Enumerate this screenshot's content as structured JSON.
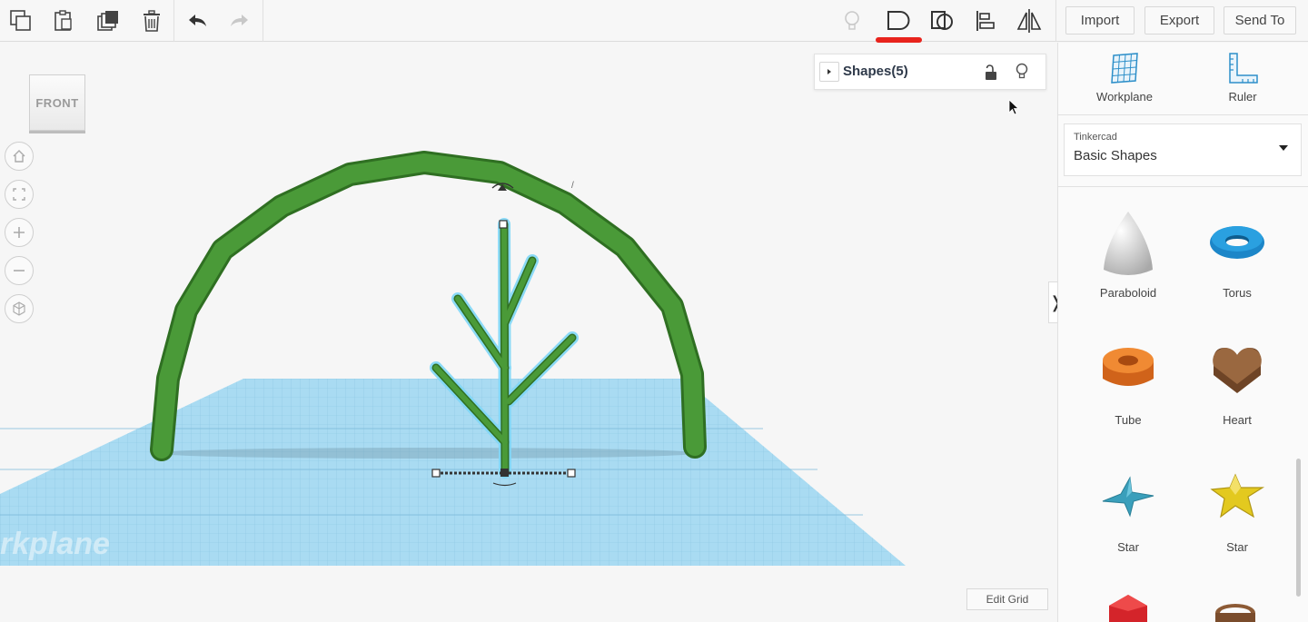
{
  "toolbar": {
    "import_label": "Import",
    "export_label": "Export",
    "send_to_label": "Send To",
    "icons": [
      "copy-icon",
      "paste-icon",
      "duplicate-icon",
      "delete-icon",
      "undo-icon",
      "redo-icon",
      "light-bulb-icon",
      "group-icon",
      "ungroup-icon",
      "align-icon",
      "mirror-icon"
    ]
  },
  "viewport": {
    "view_cube_label": "FRONT",
    "nav_icons": [
      "home-icon",
      "fit-view-icon",
      "zoom-in-icon",
      "zoom-out-icon",
      "perspective-icon"
    ],
    "workplane_watermark": "Workplane",
    "edit_grid_label": "Edit Grid",
    "collapse_tab_glyph": "❭"
  },
  "shapes_panel": {
    "title": "Shapes(5)"
  },
  "right_panel": {
    "tools": [
      {
        "label": "Workplane",
        "icon": "workplane-icon"
      },
      {
        "label": "Ruler",
        "icon": "ruler-icon"
      }
    ],
    "library": {
      "provider": "Tinkercad",
      "selected": "Basic Shapes"
    },
    "shapes": [
      {
        "name": "Paraboloid",
        "color": "#e0e0e0"
      },
      {
        "name": "Torus",
        "color": "#1f8fd1"
      },
      {
        "name": "Tube",
        "color": "#e8731f"
      },
      {
        "name": "Heart",
        "color": "#8c5a35"
      },
      {
        "name": "Star",
        "color": "#3ea8c2"
      },
      {
        "name": "Star",
        "color": "#e8d12a"
      }
    ]
  },
  "colors": {
    "accent_red": "#e8231c",
    "arch_green": "#3f8f2f",
    "workplane_blue": "#9fd6ef"
  }
}
